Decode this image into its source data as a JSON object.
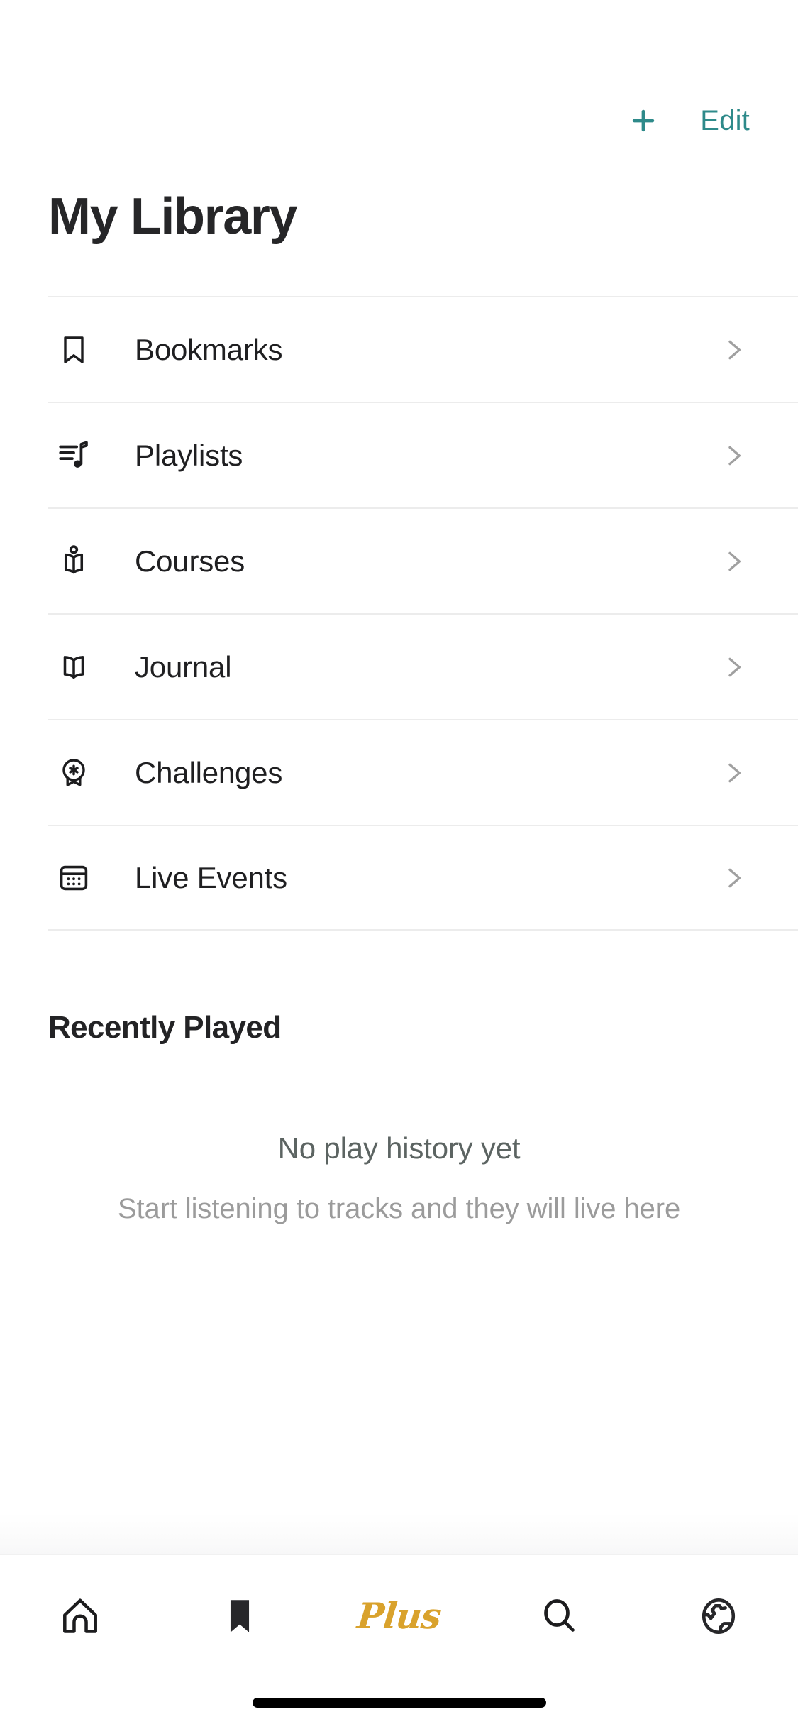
{
  "header": {
    "add_icon": "plus-icon",
    "edit_label": "Edit",
    "accent_color": "#2E8A8A"
  },
  "page_title": "My Library",
  "library": {
    "items": [
      {
        "label": "Bookmarks",
        "icon": "bookmark-icon",
        "chevron": "chevron-right-icon"
      },
      {
        "label": "Playlists",
        "icon": "playlist-music-icon",
        "chevron": "chevron-right-icon"
      },
      {
        "label": "Courses",
        "icon": "person-reading-icon",
        "chevron": "chevron-right-icon"
      },
      {
        "label": "Journal",
        "icon": "open-book-icon",
        "chevron": "chevron-right-icon"
      },
      {
        "label": "Challenges",
        "icon": "award-medal-icon",
        "chevron": "chevron-right-icon"
      },
      {
        "label": "Live Events",
        "icon": "calendar-icon",
        "chevron": "chevron-right-icon"
      }
    ]
  },
  "recently_played": {
    "section_title": "Recently Played",
    "empty_title": "No play history yet",
    "empty_subtitle": "Start listening to tracks and they will live here"
  },
  "tabbar": {
    "items": [
      {
        "name": "home",
        "icon": "home-icon",
        "label": ""
      },
      {
        "name": "library",
        "icon": "bookmark-filled-icon",
        "label": "",
        "active": true
      },
      {
        "name": "plus",
        "icon": "plus-wordmark",
        "label": "Plus",
        "color": "#D9A22C"
      },
      {
        "name": "search",
        "icon": "search-icon",
        "label": ""
      },
      {
        "name": "discover",
        "icon": "globe-icon",
        "label": ""
      }
    ]
  }
}
